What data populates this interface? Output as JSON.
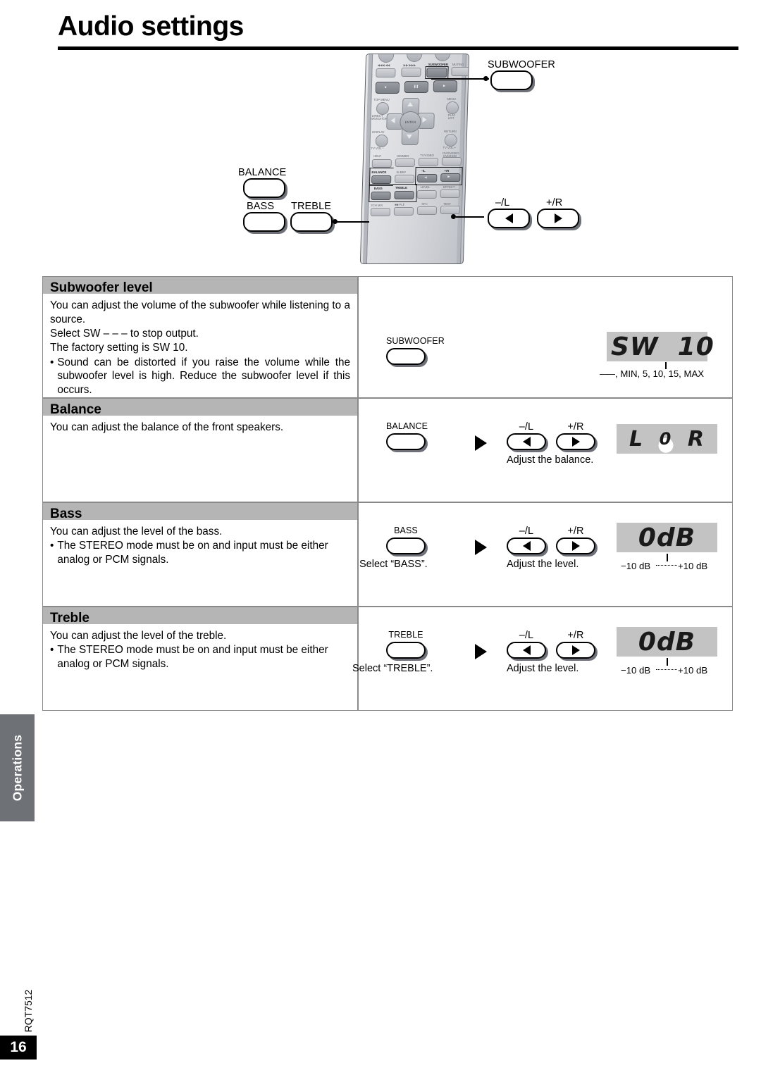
{
  "page": {
    "title": "Audio settings",
    "side_tab": "Operations",
    "doc_code": "RQT7512",
    "page_number": "16"
  },
  "remote_callouts": {
    "subwoofer_label": "SUBWOOFER",
    "balance_label": "BALANCE",
    "bass_label": "BASS",
    "treble_label": "TREBLE",
    "minus_l_label": "–/L",
    "plus_r_label": "+/R",
    "left_arrow_icon": "arrow-left-icon",
    "right_arrow_icon": "arrow-right-icon"
  },
  "remote_keys": {
    "row_transport": [
      "◀◀◀ ◀◀",
      "▶▶ ▶▶▶",
      "SUBWOOFER",
      "MUTING"
    ],
    "row_play": [
      "■",
      "‖",
      "▶"
    ],
    "top_menu": "TOP MENU",
    "menu": "MENU",
    "direct_navigator": "DIRECT NAVIGATOR",
    "play_list": "PLAY LIST",
    "enter": "ENTER",
    "display": "DISPLAY",
    "return": "RETURN",
    "tv_vol_minus": "TV VOL –",
    "tv_vol_plus": "TV VOL +",
    "row_help": [
      "HELP",
      "DIMMER",
      "TV/VIDEO",
      "DVD/VIDEO DVD/HDD"
    ],
    "row_balance": [
      "BALANCE",
      "SLEEP",
      "–/L",
      "+/R"
    ],
    "row_bass": [
      "BASS",
      "TREBLE",
      "LEVEL",
      "EFFECT"
    ],
    "row_bottom": [
      "2CH MIX",
      "PLⅡ",
      "SFC",
      "TEST"
    ]
  },
  "sections": [
    {
      "id": "subwoofer-level",
      "heading": "Subwoofer level",
      "body_lines": [
        "You can adjust the volume of the subwoofer while listening to a source.",
        "Select SW – – – to stop output.",
        "The factory setting is SW 10."
      ],
      "bullets": [
        "Sound can be distorted if you raise the volume while the subwoofer level is high. Reduce the subwoofer level if this occurs."
      ],
      "step_button": "SUBWOOFER",
      "step_caption": "",
      "has_arrow": false,
      "has_adjust_keys": false,
      "adjust_caption": "",
      "lcd_text": "SW  10",
      "lcd_type": "text",
      "range_note": "–––, MIN, 5, 10, 15, MAX",
      "range_tick": true
    },
    {
      "id": "balance",
      "heading": "Balance",
      "body_lines": [
        "You can adjust the balance of the front speakers."
      ],
      "bullets": [],
      "step_button": "BALANCE",
      "step_caption": "",
      "has_arrow": true,
      "has_adjust_keys": true,
      "adjust_caption": "Adjust the balance.",
      "lcd_left": "L",
      "lcd_center": "0",
      "lcd_right": "R",
      "lcd_type": "balance",
      "range_note": "",
      "range_tick": false
    },
    {
      "id": "bass",
      "heading": "Bass",
      "body_lines": [
        "You can adjust the level of the bass."
      ],
      "bullets": [
        "The STEREO mode must be on and input must be either analog or PCM signals."
      ],
      "step_button": "BASS",
      "step_caption": "Select “BASS”.",
      "has_arrow": true,
      "has_adjust_keys": true,
      "adjust_caption": "Adjust the level.",
      "lcd_text": "0dB",
      "lcd_type": "text",
      "range_note_left": "−10 dB",
      "range_note_right": "+10 dB",
      "range_tick": true
    },
    {
      "id": "treble",
      "heading": "Treble",
      "body_lines": [
        "You can adjust the level of the treble."
      ],
      "bullets": [
        "The STEREO mode must be on and input must be either analog or PCM signals."
      ],
      "step_button": "TREBLE",
      "step_caption": "Select “TREBLE”.",
      "has_arrow": true,
      "has_adjust_keys": true,
      "adjust_caption": "Adjust the level.",
      "lcd_text": "0dB",
      "lcd_type": "text",
      "range_note_left": "−10 dB",
      "range_note_right": "+10 dB",
      "range_tick": true
    }
  ],
  "adjust_keys": {
    "minus_l_label": "–/L",
    "plus_r_label": "+/R"
  },
  "colors": {
    "header_band": "#b5b5b5",
    "lcd_background": "#c3c3c3",
    "side_tab": "#6e7175",
    "rule": "#000000"
  }
}
